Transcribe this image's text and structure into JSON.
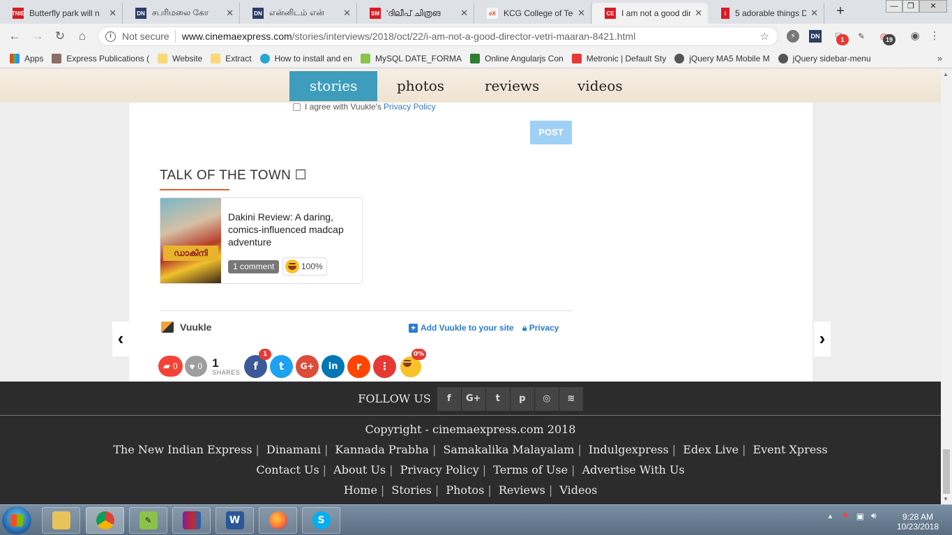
{
  "browser": {
    "tabs": [
      {
        "title": "Butterfly park will n",
        "fav_label": "TNIE",
        "fav_color": "#d71c24"
      },
      {
        "title": "சபரிமலை கோ",
        "fav_label": "DN",
        "fav_color": "#2c3e66"
      },
      {
        "title": "என்னிடம் என்",
        "fav_label": "DN",
        "fav_color": "#2c3e66"
      },
      {
        "title": "'ദിലീപ് ചിത്രങ",
        "fav_label": "SM",
        "fav_color": "#d71c24"
      },
      {
        "title": "KCG College of Tec",
        "fav_label": "eX",
        "fav_color": "#f5f5f5"
      },
      {
        "title": "I am not a good dir",
        "fav_label": "CE",
        "fav_color": "#d71c24"
      },
      {
        "title": "5 adorable things D",
        "fav_label": "i",
        "fav_color": "#d71c24"
      }
    ],
    "new_tab": "+",
    "not_secure": "Not secure",
    "url_host": "www.cinemaexpress.com",
    "url_path": "/stories/interviews/2018/oct/22/i-am-not-a-good-director-vetri-maaran-8421.html",
    "ext_badges": {
      "a": "1",
      "b": "19"
    },
    "bookmarks": [
      {
        "label": "Apps",
        "color": "#e64a19"
      },
      {
        "label": "Express Publications (",
        "color": "#8d6e63"
      },
      {
        "label": "Website",
        "color": "#f9d976"
      },
      {
        "label": "Extract",
        "color": "#f9d976"
      },
      {
        "label": "How to install and en",
        "color": "#26a6d1"
      },
      {
        "label": "MySQL DATE_FORMA",
        "color": "#8bc34a"
      },
      {
        "label": "Online Angularjs Con",
        "color": "#2e7d32"
      },
      {
        "label": "Metronic | Default Sty",
        "color": "#e53935"
      },
      {
        "label": "jQuery MA5 Mobile M",
        "color": "#555555"
      },
      {
        "label": "jQuery sidebar-menu",
        "color": "#555555"
      }
    ],
    "bookmarks_more": "»"
  },
  "site_nav": {
    "items": [
      "stories",
      "photos",
      "reviews",
      "videos"
    ],
    "active_color": "#3e9dbc"
  },
  "comment_form": {
    "agree_text": "I agree with Vuukle's",
    "privacy_policy": "Privacy Policy",
    "post_label": "POST"
  },
  "talk_of_the_town": {
    "heading": "TALK OF THE TOWN ☐",
    "card": {
      "thumb_text": "ഡാകിനി",
      "title": "Dakini Review: A daring, comics-influenced madcap adventure",
      "comments": "1 comment",
      "reaction_pct": "100%"
    }
  },
  "vuukle": {
    "brand": "Vuukle",
    "add_label": "Add Vuukle to your site",
    "privacy_label": "Privacy",
    "comments_count": "0",
    "likes_count": "0",
    "shares_count": "1",
    "shares_label": "SHARES",
    "facebook_badge": "1",
    "emoji_badge": "0%",
    "share_buttons": [
      {
        "name": "facebook",
        "glyph": "f",
        "color": "#3b5998"
      },
      {
        "name": "twitter",
        "glyph": "t",
        "color": "#1da1f2"
      },
      {
        "name": "google-plus",
        "glyph": "G+",
        "color": "#dd4b39"
      },
      {
        "name": "linkedin",
        "glyph": "in",
        "color": "#0077b5"
      },
      {
        "name": "reddit",
        "glyph": "r",
        "color": "#ff4500"
      },
      {
        "name": "more",
        "glyph": "⋮",
        "color": "#e53935"
      }
    ]
  },
  "footer": {
    "follow_us": "FOLLOW US",
    "social": [
      "f",
      "G+",
      "t",
      "p",
      "◎",
      "≋"
    ],
    "copyright": "Copyright - cinemaexpress.com 2018",
    "network_links": [
      "The New Indian Express",
      "Dinamani",
      "Kannada Prabha",
      "Samakalika Malayalam",
      "Indulgexpress",
      "Edex Live",
      "Event Xpress"
    ],
    "info_links": [
      "Contact Us",
      "About Us",
      "Privacy Policy",
      "Terms of Use",
      "Advertise With Us"
    ],
    "section_links": [
      "Home",
      "Stories",
      "Photos",
      "Reviews",
      "Videos"
    ]
  },
  "taskbar": {
    "apps": [
      "explorer",
      "chrome",
      "notepad",
      "winrar",
      "word",
      "firefox",
      "skype"
    ],
    "time": "9:28 AM",
    "date": "10/23/2018"
  }
}
